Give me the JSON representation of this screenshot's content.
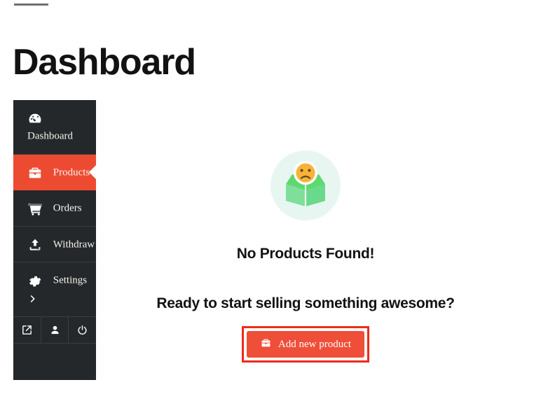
{
  "page": {
    "title": "Dashboard"
  },
  "sidebar": {
    "items": [
      {
        "label": "Dashboard",
        "icon": "tachometer-icon",
        "active": false
      },
      {
        "label": "Products",
        "icon": "briefcase-icon",
        "active": true
      },
      {
        "label": "Orders",
        "icon": "shopping-cart-icon",
        "active": false
      },
      {
        "label": "Withdraw",
        "icon": "upload-icon",
        "active": false
      },
      {
        "label": "Settings",
        "icon": "gear-icon",
        "active": false
      }
    ],
    "footer_icons": [
      {
        "name": "external-link-icon"
      },
      {
        "name": "user-icon"
      },
      {
        "name": "power-icon"
      }
    ]
  },
  "main": {
    "empty_state": {
      "illustration": "sad-face-empty-box-icon",
      "title": "No Products Found!",
      "subtitle": "Ready to start selling something awesome?",
      "cta_label": "Add new product",
      "cta_icon": "briefcase-icon"
    }
  },
  "colors": {
    "sidebar_bg": "#25282a",
    "accent": "#ec4b32",
    "cta_bg": "#ef4e38",
    "highlight_border": "#ec2b1a",
    "illustration_circle": "#e8f6f1",
    "illustration_box_light": "#7fdf9a",
    "illustration_box_dark": "#5ed96f",
    "illustration_face": "#f7b733"
  }
}
